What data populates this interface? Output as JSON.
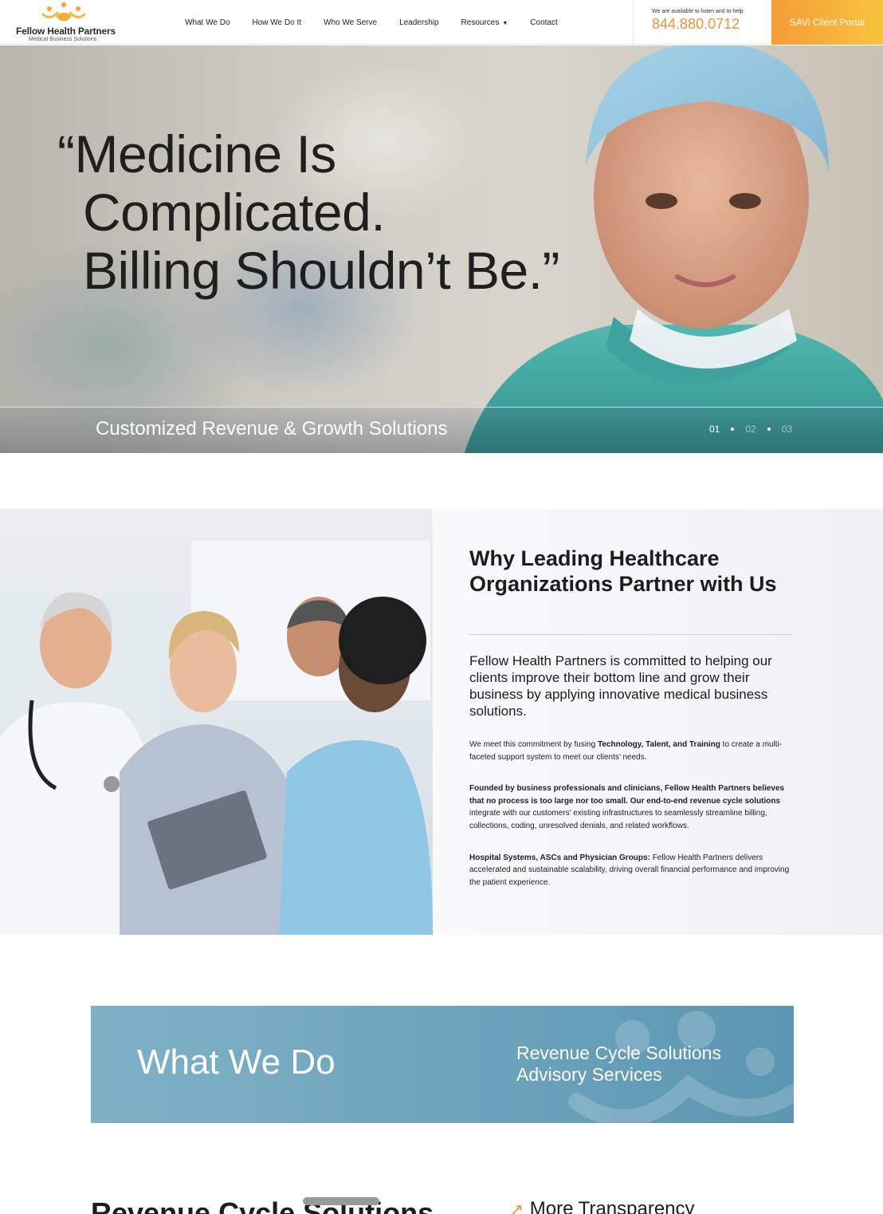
{
  "header": {
    "logo": {
      "name": "Fellow Health Partners",
      "tagline": "Medical Business Solutions"
    },
    "nav": [
      {
        "label": "What We Do"
      },
      {
        "label": "How We Do It"
      },
      {
        "label": "Who We Serve"
      },
      {
        "label": "Leadership"
      },
      {
        "label": "Resources",
        "dropdown": true
      },
      {
        "label": "Contact"
      }
    ],
    "contact_note": "We are available to listen and to help",
    "phone": "844.880.0712",
    "portal_button": "SAVi Client Portal"
  },
  "hero": {
    "quote_lines": [
      "“Medicine Is",
      "Complicated.",
      "Billing Shouldn’t Be.”"
    ],
    "caption": "Customized Revenue & Growth Solutions",
    "slides": [
      "01",
      "02",
      "03"
    ],
    "active_slide": "01"
  },
  "why": {
    "title_lines": [
      "Why Leading Healthcare",
      "Organizations Partner with Us"
    ],
    "lead": "Fellow Health Partners is committed to helping our clients improve their bottom line and grow their business by applying innovative medical business solutions.",
    "p1_a": "We meet this commitment by fusing ",
    "p1_bold": "Technology, Talent, and Training",
    "p1_b": " to create a multi-faceted support system to meet our clients’ needs.",
    "p2_bold_a": "Founded by business professionals and clinicians, Fellow Health Partners believes that no process is too large nor too small.  Our end-to-end revenue cycle solutions",
    "p2_b": " integrate with our customers’ existing infrastructures to seamlessly streamline billing, collections, coding, unresolved denials, and related workflows.",
    "p3_bold": "Hospital Systems, ASCs and Physician Groups:",
    "p3_b": "  Fellow Health Partners delivers accelerated and sustainable scalability, driving overall financial performance and improving the patient experience."
  },
  "what_we_do": {
    "title": "What We Do",
    "links": [
      "Revenue Cycle Solutions",
      "Advisory Services"
    ]
  },
  "next_section": {
    "title": "Revenue Cycle Solutions",
    "first_item": "More Transparency"
  },
  "colors": {
    "accent_orange": "#f0913a",
    "portal_gradient_start": "#f59b36",
    "portal_gradient_end": "#f7c43f",
    "banner_blue": "#6ea5bd"
  }
}
